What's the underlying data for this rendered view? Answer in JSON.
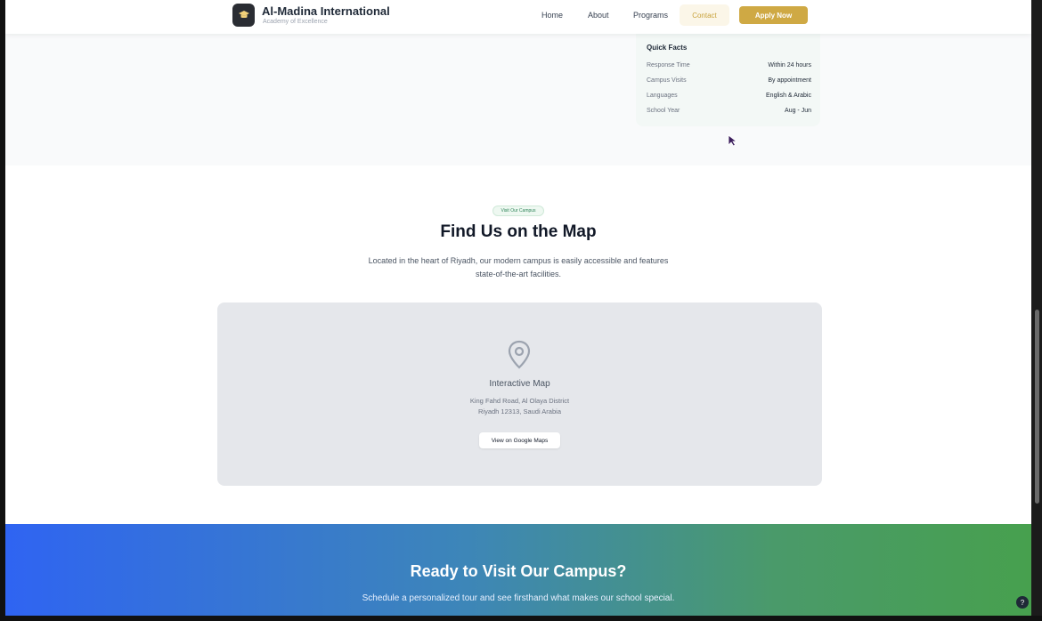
{
  "header": {
    "brand_name": "Al-Madina International",
    "brand_tagline": "Academy of Excellence",
    "nav": [
      "Home",
      "About",
      "Programs"
    ],
    "contact_label": "Contact",
    "apply_label": "Apply Now",
    "logo_icon": "graduation-cap-icon"
  },
  "quick_facts": {
    "title": "Quick Facts",
    "rows": [
      {
        "label": "Response Time",
        "value": "Within 24 hours"
      },
      {
        "label": "Campus Visits",
        "value": "By appointment"
      },
      {
        "label": "Languages",
        "value": "English & Arabic"
      },
      {
        "label": "School Year",
        "value": "Aug - Jun"
      }
    ]
  },
  "map_section": {
    "badge": "Visit Our Campus",
    "title": "Find Us on the Map",
    "subtitle": "Located in the heart of Riyadh, our modern campus is easily accessible and features state-of-the-art facilities.",
    "map_label": "Interactive Map",
    "address_line1": "King Fahd Road, Al Olaya District",
    "address_line2": "Riyadh 12313, Saudi Arabia",
    "button_label": "View on Google Maps",
    "pin_icon": "map-pin-icon"
  },
  "cta": {
    "title": "Ready to Visit Our Campus?",
    "subtitle": "Schedule a personalized tour and see firsthand what makes our school special."
  },
  "help_label": "?",
  "colors": {
    "accent_gold": "#cfa944",
    "contact_bg": "#fbf6e8",
    "cta_start": "#2f64f2",
    "cta_end": "#47a04e",
    "map_bg": "#e5e7eb"
  }
}
